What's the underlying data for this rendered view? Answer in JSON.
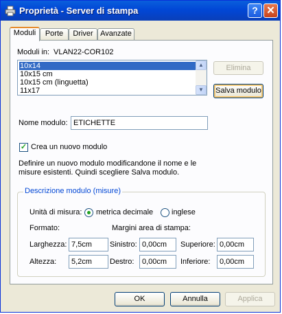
{
  "window": {
    "title": "Proprietà - Server di stampa",
    "help_symbol": "?",
    "close_symbol": "✕",
    "icon": "printer-icon"
  },
  "tabs": [
    {
      "label": "Moduli",
      "active": true
    },
    {
      "label": "Porte",
      "active": false
    },
    {
      "label": "Driver",
      "active": false
    },
    {
      "label": "Avanzate",
      "active": false
    }
  ],
  "forms": {
    "moduli_in_label": "Moduli in:",
    "server_name": "VLAN22-COR102",
    "list": [
      "10x14",
      "10x15 cm",
      "10x15 cm (linguetta)",
      "11x17"
    ],
    "selected_index": 0,
    "delete_button": "Elimina",
    "save_button": "Salva modulo",
    "name_label": "Nome modulo:",
    "name_value": "ETICHETTE",
    "create_new_label": "Crea un nuovo modulo",
    "create_new_checked": true,
    "help_line1": "Definire un nuovo modulo modificandone il nome e le",
    "help_line2": "misure esistenti. Quindi scegliere Salva modulo."
  },
  "description": {
    "group_title": "Descrizione modulo (misure)",
    "units_label": "Unità di misura:",
    "metric_label": "metrica decimale",
    "imperial_label": "inglese",
    "metric_selected": true,
    "format_label": "Formato:",
    "margins_label": "Margini area di stampa:",
    "width_label": "Larghezza:",
    "width_value": "7,5cm",
    "height_label": "Altezza:",
    "height_value": "5,2cm",
    "left_label": "Sinistro:",
    "left_value": "0,00cm",
    "right_label": "Destro:",
    "right_value": "0,00cm",
    "top_label": "Superiore:",
    "top_value": "0,00cm",
    "bottom_label": "Inferiore:",
    "bottom_value": "0,00cm"
  },
  "footer": {
    "ok": "OK",
    "cancel": "Annulla",
    "apply": "Applica"
  },
  "colors": {
    "titlebar": "#0147d6",
    "selection": "#316ac5",
    "group_title": "#0046d5",
    "check": "#21a121"
  }
}
